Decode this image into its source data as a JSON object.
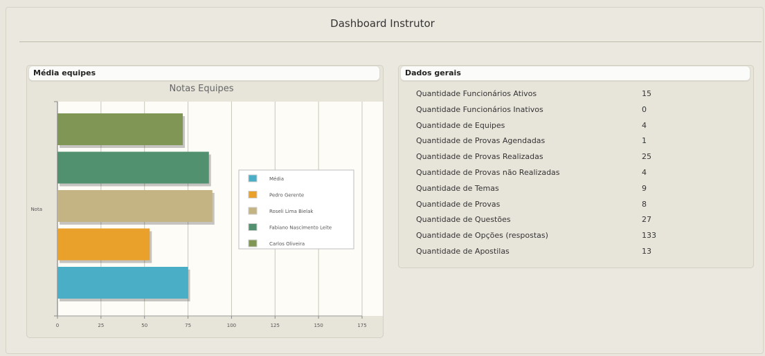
{
  "page": {
    "title": "Dashboard Instrutor"
  },
  "left_panel": {
    "header": "Média equipes"
  },
  "right_panel": {
    "header": "Dados gerais",
    "rows": [
      {
        "label": "Quantidade Funcionários Ativos",
        "value": "15"
      },
      {
        "label": "Quantidade Funcionários Inativos",
        "value": "0"
      },
      {
        "label": "Quantidade de Equipes",
        "value": "4"
      },
      {
        "label": "Quantidade de Provas Agendadas",
        "value": "1"
      },
      {
        "label": "Quantidade de Provas Realizadas",
        "value": "25"
      },
      {
        "label": "Quantidade de Provas não Realizadas",
        "value": "4"
      },
      {
        "label": "Quantidade de Temas",
        "value": "9"
      },
      {
        "label": "Quantidade de Provas",
        "value": "8"
      },
      {
        "label": "Quantidade de Questões",
        "value": "27"
      },
      {
        "label": "Quantidade de Opções (respostas)",
        "value": "133"
      },
      {
        "label": "Quantidade de Apostilas",
        "value": "13"
      }
    ]
  },
  "chart_data": {
    "type": "bar",
    "orientation": "horizontal",
    "title": "Notas Equipes",
    "ylabel": "Nota",
    "xlabel": "",
    "category": "Nota",
    "xlim": [
      0,
      175
    ],
    "x_ticks": [
      "0",
      "25",
      "50",
      "75",
      "100",
      "125",
      "150",
      "175"
    ],
    "grid": true,
    "legend_position": "right",
    "series": [
      {
        "name": "Média",
        "value": 75,
        "color": "#4aafc6"
      },
      {
        "name": "Pedro Gerente",
        "value": 53,
        "color": "#e9a12b"
      },
      {
        "name": "Roseli Lima Bielak",
        "value": 89,
        "color": "#c4b383"
      },
      {
        "name": "Fabiano Nascimento Leite",
        "value": 87,
        "color": "#52916f"
      },
      {
        "name": "Carlos Oliveira",
        "value": 72,
        "color": "#7f9655"
      }
    ]
  }
}
